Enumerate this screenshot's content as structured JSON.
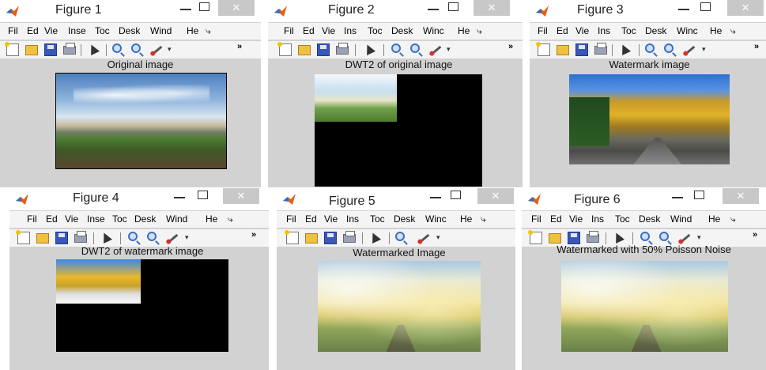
{
  "windows": [
    {
      "title": "Figure 1",
      "axes_title": "Original image",
      "close_glyph": "✕",
      "menu": [
        "Fil",
        "Ed",
        "Vie",
        "Inse",
        "Toc",
        "Desk",
        "Wind",
        "He",
        "⤷"
      ]
    },
    {
      "title": "Figure 2",
      "axes_title": "DWT2 of original image",
      "close_glyph": "✕",
      "menu": [
        "Fil",
        "Ed",
        "Vie",
        "Ins",
        "Toc",
        "Desk",
        "Winc",
        "He",
        "⤷"
      ]
    },
    {
      "title": "Figure 3",
      "axes_title": "Watermark image",
      "close_glyph": "✕",
      "menu": [
        "Fil",
        "Ed",
        "Vie",
        "Ins",
        "Toc",
        "Desk",
        "Winc",
        "He",
        "⤷"
      ]
    },
    {
      "title": "Figure 4",
      "axes_title": "DWT2 of watermark image",
      "close_glyph": "✕",
      "menu": [
        "Fil",
        "Ed",
        "Vie",
        "Inse",
        "Toc",
        "Desk",
        "Wind",
        "He",
        "⤷"
      ]
    },
    {
      "title": "Figure 5",
      "axes_title": "Watermarked Image",
      "close_glyph": "✕",
      "menu": [
        "Fil",
        "Ed",
        "Vie",
        "Ins",
        "Toc",
        "Desk",
        "Winc",
        "He",
        "⤷"
      ]
    },
    {
      "title": "Figure 6",
      "axes_title": "Watermarked with 50% Poisson Noise",
      "close_glyph": "✕",
      "menu": [
        "Fil",
        "Ed",
        "Vie",
        "Ins",
        "Toc",
        "Desk",
        "Wind",
        "He",
        "⤷"
      ]
    }
  ],
  "toolbar_more": "»",
  "toolbar_dropdown": "▾",
  "icons": [
    "matlab-icon",
    "new-figure-icon",
    "open-folder-icon",
    "save-icon",
    "print-icon",
    "pointer-icon",
    "zoom-in-icon",
    "zoom-out-icon",
    "brush-icon"
  ],
  "colors": {
    "window_bg": "#d2d2d2",
    "menu_bg": "#f4f4f4",
    "close_btn": "#c8c8c8"
  }
}
